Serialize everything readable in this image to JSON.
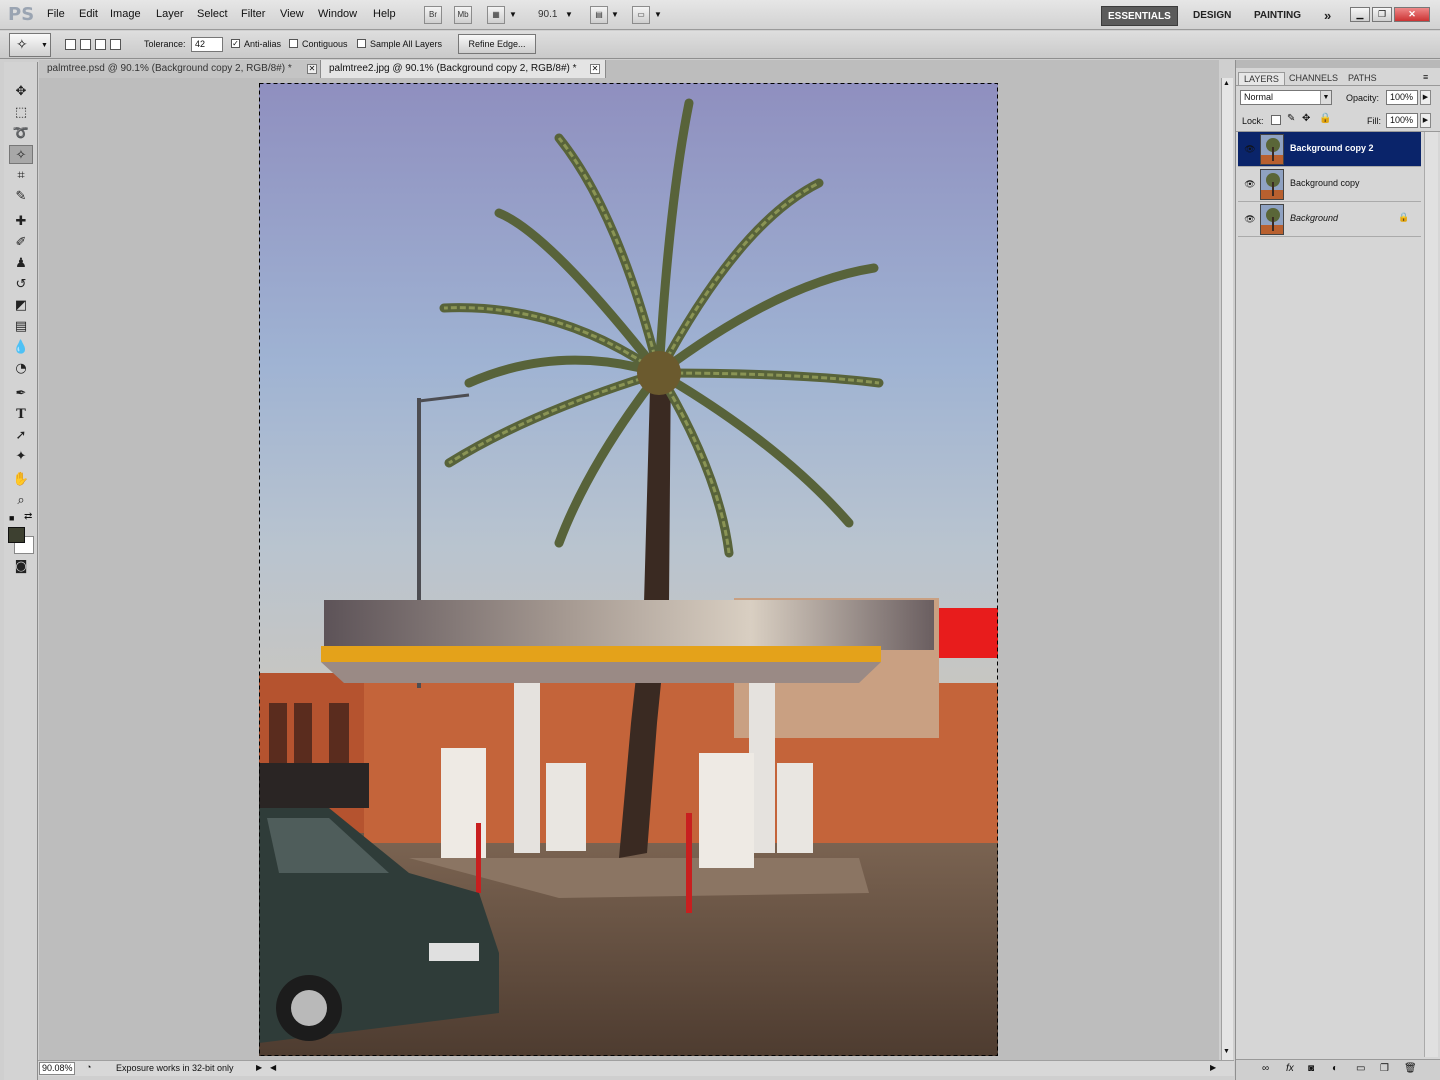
{
  "menubar": {
    "logo": "PS",
    "items": [
      "File",
      "Edit",
      "Image",
      "Layer",
      "Select",
      "Filter",
      "View",
      "Window",
      "Help"
    ],
    "bridge_btn": "Br",
    "minibridge_btn": "Mb",
    "zoom_value": "90.1",
    "workspaces": {
      "essentials": "ESSENTIALS",
      "design": "DESIGN",
      "painting": "PAINTING",
      "more": "»"
    }
  },
  "options": {
    "tolerance_label": "Tolerance:",
    "tolerance_value": "42",
    "antialias_label": "Anti-alias",
    "antialias_checked": true,
    "contiguous_label": "Contiguous",
    "contiguous_checked": false,
    "sample_all_label": "Sample All Layers",
    "sample_all_checked": false,
    "refine_edge": "Refine Edge..."
  },
  "tabs": [
    {
      "label": "palmtree.psd @ 90.1% (Background copy 2, RGB/8#) *",
      "active": false
    },
    {
      "label": "palmtree2.jpg @ 90.1% (Background copy 2, RGB/8#) *",
      "active": true
    }
  ],
  "status": {
    "zoom": "90.08%",
    "message": "Exposure works in 32-bit only"
  },
  "panel": {
    "tabs": [
      "LAYERS",
      "CHANNELS",
      "PATHS"
    ],
    "blend_mode": "Normal",
    "opacity_label": "Opacity:",
    "opacity": "100%",
    "lock_label": "Lock:",
    "fill_label": "Fill:",
    "fill": "100%",
    "layers": [
      {
        "name": "Background copy 2",
        "selected": true,
        "locked": false
      },
      {
        "name": "Background copy",
        "selected": false,
        "locked": false
      },
      {
        "name": "Background",
        "selected": false,
        "locked": true
      }
    ]
  },
  "colors": {
    "selection": "#0a246a",
    "foreground": "#3d4030",
    "background": "#ffffff"
  }
}
